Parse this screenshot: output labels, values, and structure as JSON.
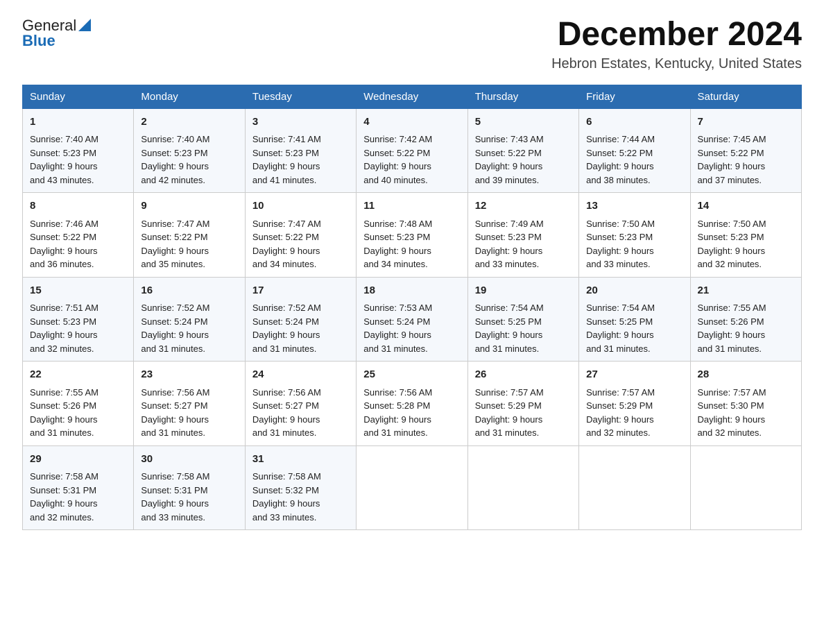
{
  "logo": {
    "text_general": "General",
    "text_blue": "Blue",
    "aria": "GeneralBlue logo"
  },
  "title": {
    "month_year": "December 2024",
    "location": "Hebron Estates, Kentucky, United States"
  },
  "days_of_week": [
    "Sunday",
    "Monday",
    "Tuesday",
    "Wednesday",
    "Thursday",
    "Friday",
    "Saturday"
  ],
  "weeks": [
    [
      {
        "day": "1",
        "sunrise": "7:40 AM",
        "sunset": "5:23 PM",
        "daylight": "9 hours and 43 minutes."
      },
      {
        "day": "2",
        "sunrise": "7:40 AM",
        "sunset": "5:23 PM",
        "daylight": "9 hours and 42 minutes."
      },
      {
        "day": "3",
        "sunrise": "7:41 AM",
        "sunset": "5:23 PM",
        "daylight": "9 hours and 41 minutes."
      },
      {
        "day": "4",
        "sunrise": "7:42 AM",
        "sunset": "5:22 PM",
        "daylight": "9 hours and 40 minutes."
      },
      {
        "day": "5",
        "sunrise": "7:43 AM",
        "sunset": "5:22 PM",
        "daylight": "9 hours and 39 minutes."
      },
      {
        "day": "6",
        "sunrise": "7:44 AM",
        "sunset": "5:22 PM",
        "daylight": "9 hours and 38 minutes."
      },
      {
        "day": "7",
        "sunrise": "7:45 AM",
        "sunset": "5:22 PM",
        "daylight": "9 hours and 37 minutes."
      }
    ],
    [
      {
        "day": "8",
        "sunrise": "7:46 AM",
        "sunset": "5:22 PM",
        "daylight": "9 hours and 36 minutes."
      },
      {
        "day": "9",
        "sunrise": "7:47 AM",
        "sunset": "5:22 PM",
        "daylight": "9 hours and 35 minutes."
      },
      {
        "day": "10",
        "sunrise": "7:47 AM",
        "sunset": "5:22 PM",
        "daylight": "9 hours and 34 minutes."
      },
      {
        "day": "11",
        "sunrise": "7:48 AM",
        "sunset": "5:23 PM",
        "daylight": "9 hours and 34 minutes."
      },
      {
        "day": "12",
        "sunrise": "7:49 AM",
        "sunset": "5:23 PM",
        "daylight": "9 hours and 33 minutes."
      },
      {
        "day": "13",
        "sunrise": "7:50 AM",
        "sunset": "5:23 PM",
        "daylight": "9 hours and 33 minutes."
      },
      {
        "day": "14",
        "sunrise": "7:50 AM",
        "sunset": "5:23 PM",
        "daylight": "9 hours and 32 minutes."
      }
    ],
    [
      {
        "day": "15",
        "sunrise": "7:51 AM",
        "sunset": "5:23 PM",
        "daylight": "9 hours and 32 minutes."
      },
      {
        "day": "16",
        "sunrise": "7:52 AM",
        "sunset": "5:24 PM",
        "daylight": "9 hours and 31 minutes."
      },
      {
        "day": "17",
        "sunrise": "7:52 AM",
        "sunset": "5:24 PM",
        "daylight": "9 hours and 31 minutes."
      },
      {
        "day": "18",
        "sunrise": "7:53 AM",
        "sunset": "5:24 PM",
        "daylight": "9 hours and 31 minutes."
      },
      {
        "day": "19",
        "sunrise": "7:54 AM",
        "sunset": "5:25 PM",
        "daylight": "9 hours and 31 minutes."
      },
      {
        "day": "20",
        "sunrise": "7:54 AM",
        "sunset": "5:25 PM",
        "daylight": "9 hours and 31 minutes."
      },
      {
        "day": "21",
        "sunrise": "7:55 AM",
        "sunset": "5:26 PM",
        "daylight": "9 hours and 31 minutes."
      }
    ],
    [
      {
        "day": "22",
        "sunrise": "7:55 AM",
        "sunset": "5:26 PM",
        "daylight": "9 hours and 31 minutes."
      },
      {
        "day": "23",
        "sunrise": "7:56 AM",
        "sunset": "5:27 PM",
        "daylight": "9 hours and 31 minutes."
      },
      {
        "day": "24",
        "sunrise": "7:56 AM",
        "sunset": "5:27 PM",
        "daylight": "9 hours and 31 minutes."
      },
      {
        "day": "25",
        "sunrise": "7:56 AM",
        "sunset": "5:28 PM",
        "daylight": "9 hours and 31 minutes."
      },
      {
        "day": "26",
        "sunrise": "7:57 AM",
        "sunset": "5:29 PM",
        "daylight": "9 hours and 31 minutes."
      },
      {
        "day": "27",
        "sunrise": "7:57 AM",
        "sunset": "5:29 PM",
        "daylight": "9 hours and 32 minutes."
      },
      {
        "day": "28",
        "sunrise": "7:57 AM",
        "sunset": "5:30 PM",
        "daylight": "9 hours and 32 minutes."
      }
    ],
    [
      {
        "day": "29",
        "sunrise": "7:58 AM",
        "sunset": "5:31 PM",
        "daylight": "9 hours and 32 minutes."
      },
      {
        "day": "30",
        "sunrise": "7:58 AM",
        "sunset": "5:31 PM",
        "daylight": "9 hours and 33 minutes."
      },
      {
        "day": "31",
        "sunrise": "7:58 AM",
        "sunset": "5:32 PM",
        "daylight": "9 hours and 33 minutes."
      },
      null,
      null,
      null,
      null
    ]
  ],
  "labels": {
    "sunrise": "Sunrise:",
    "sunset": "Sunset:",
    "daylight": "Daylight:"
  }
}
